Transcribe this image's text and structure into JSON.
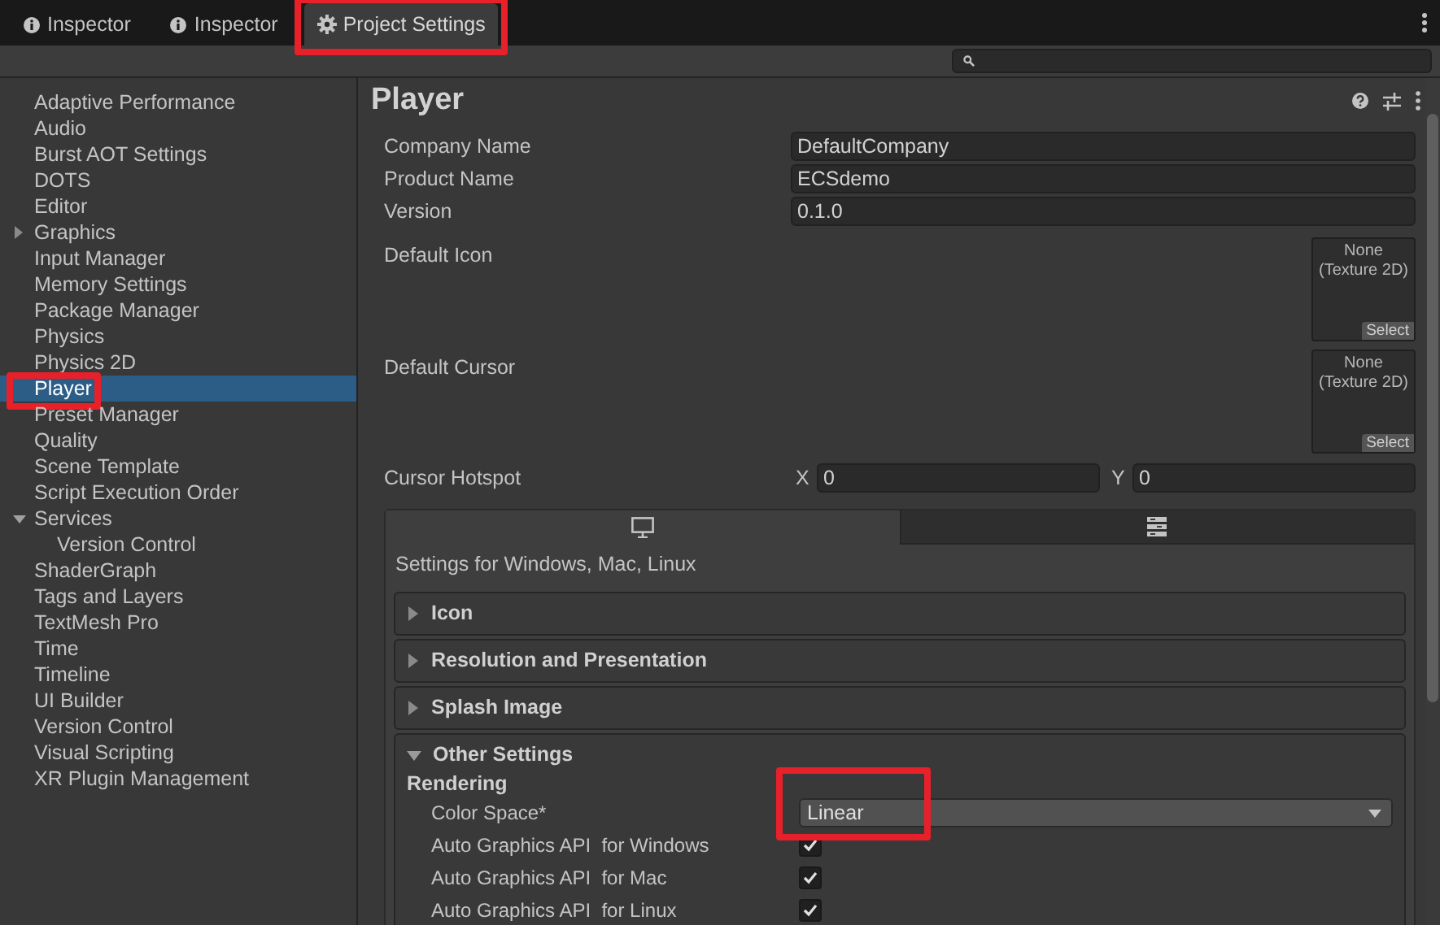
{
  "tabs": [
    {
      "label": "Inspector",
      "selected": false,
      "highlighted": false
    },
    {
      "label": "Inspector",
      "selected": false,
      "highlighted": false
    },
    {
      "label": "Project Settings",
      "selected": true,
      "highlighted": true
    }
  ],
  "sidebar": {
    "items": [
      {
        "label": "Adaptive Performance",
        "selected": false,
        "highlighted": false
      },
      {
        "label": "Audio",
        "selected": false,
        "highlighted": false
      },
      {
        "label": "Burst AOT Settings",
        "selected": false,
        "highlighted": false
      },
      {
        "label": "DOTS",
        "selected": false,
        "highlighted": false
      },
      {
        "label": "Editor",
        "selected": false,
        "highlighted": false
      },
      {
        "label": "Graphics",
        "selected": false,
        "highlighted": false,
        "expanded": false
      },
      {
        "label": "Input Manager",
        "selected": false,
        "highlighted": false
      },
      {
        "label": "Memory Settings",
        "selected": false,
        "highlighted": false
      },
      {
        "label": "Package Manager",
        "selected": false,
        "highlighted": false
      },
      {
        "label": "Physics",
        "selected": false,
        "highlighted": false
      },
      {
        "label": "Physics 2D",
        "selected": false,
        "highlighted": false
      },
      {
        "label": "Player",
        "selected": true,
        "highlighted": true
      },
      {
        "label": "Preset Manager",
        "selected": false,
        "highlighted": false
      },
      {
        "label": "Quality",
        "selected": false,
        "highlighted": false
      },
      {
        "label": "Scene Template",
        "selected": false,
        "highlighted": false
      },
      {
        "label": "Script Execution Order",
        "selected": false,
        "highlighted": false
      },
      {
        "label": "Services",
        "selected": false,
        "highlighted": false,
        "expanded": true,
        "children": [
          {
            "label": "Version Control",
            "selected": false,
            "highlighted": false
          }
        ]
      },
      {
        "label": "ShaderGraph",
        "selected": false,
        "highlighted": false
      },
      {
        "label": "Tags and Layers",
        "selected": false,
        "highlighted": false
      },
      {
        "label": "TextMesh Pro",
        "selected": false,
        "highlighted": false
      },
      {
        "label": "Time",
        "selected": false,
        "highlighted": false
      },
      {
        "label": "Timeline",
        "selected": false,
        "highlighted": false
      },
      {
        "label": "UI Builder",
        "selected": false,
        "highlighted": false
      },
      {
        "label": "Version Control",
        "selected": false,
        "highlighted": false
      },
      {
        "label": "Visual Scripting",
        "selected": false,
        "highlighted": false
      },
      {
        "label": "XR Plugin Management",
        "selected": false,
        "highlighted": false
      }
    ]
  },
  "panel": {
    "title": "Player",
    "text_fields": [
      {
        "label": "Company Name",
        "value": "DefaultCompany"
      },
      {
        "label": "Product Name",
        "value": "ECSdemo"
      },
      {
        "label": "Version",
        "value": "0.1.0"
      }
    ],
    "textures": [
      {
        "label": "Default Icon",
        "value": "None\n(Texture 2D)",
        "button": "Select"
      },
      {
        "label": "Default Cursor",
        "value": "None\n(Texture 2D)",
        "button": "Select"
      }
    ],
    "hotspot": {
      "label": "Cursor Hotspot",
      "x_label": "X",
      "x_value": "0",
      "y_label": "Y",
      "y_value": "0"
    },
    "platform_tabs": [
      {
        "selected": true
      },
      {
        "selected": false
      }
    ],
    "platform_caption": "Settings for Windows, Mac, Linux",
    "sections": [
      {
        "title": "Icon",
        "expanded": false
      },
      {
        "title": "Resolution and Presentation",
        "expanded": false
      },
      {
        "title": "Splash Image",
        "expanded": false
      },
      {
        "title": "Other Settings",
        "expanded": true,
        "subheading": "Rendering",
        "rows": [
          {
            "kind": "dropdown",
            "label": "Color Space*",
            "value": "Linear",
            "highlighted": true
          },
          {
            "kind": "checkbox",
            "label": "Auto Graphics API  for Windows",
            "checked": true
          },
          {
            "kind": "checkbox",
            "label": "Auto Graphics API  for Mac",
            "checked": true
          },
          {
            "kind": "checkbox",
            "label": "Auto Graphics API  for Linux",
            "checked": true
          }
        ]
      }
    ]
  }
}
